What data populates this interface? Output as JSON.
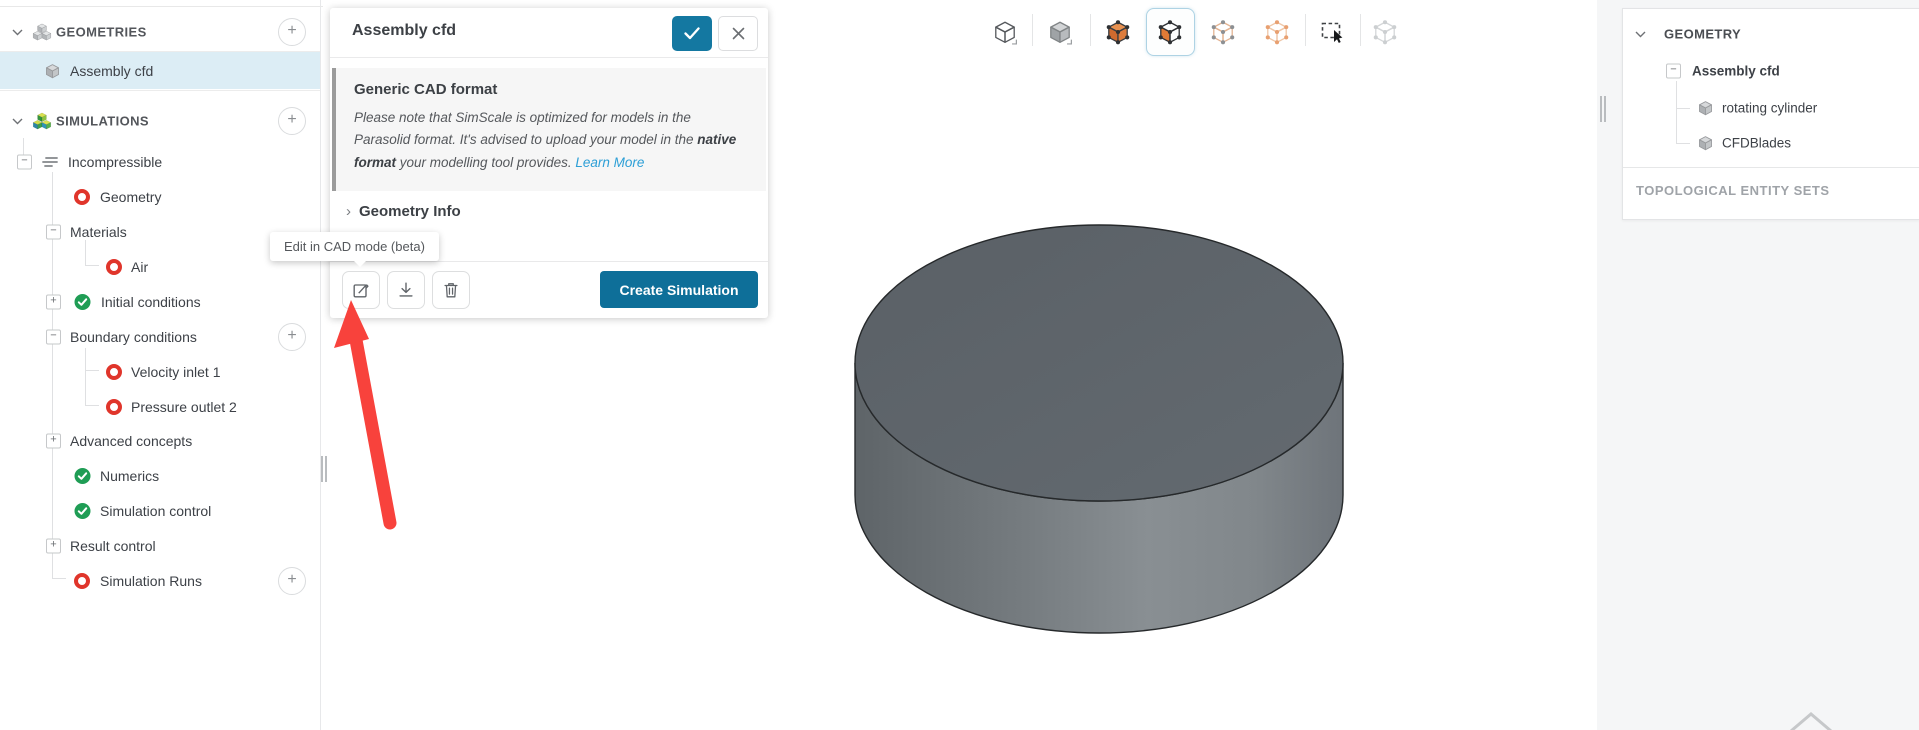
{
  "colors": {
    "accent": "#0e6f99",
    "selected_row": "#dcedf5",
    "link": "#2d9fd6",
    "arrow": "#f8423c",
    "status_incomplete": "#e0352b",
    "status_complete": "#1f9d55",
    "active_icon_border": "#aed3e4"
  },
  "sidebar": {
    "items": [
      {
        "label": "GEOMETRIES",
        "level": "header",
        "icon": "cubes-gray-icon",
        "chevron": true,
        "plus": true
      },
      {
        "label": "Assembly cfd",
        "level": "assembly",
        "icon": "cube-icon",
        "selected": true
      },
      {
        "label": "SIMULATIONS",
        "level": "header",
        "icon": "cubes-color-icon",
        "chevron": true,
        "plus": true
      },
      {
        "label": "Incompressible",
        "level": "l0",
        "icon": "flow-lines-icon",
        "expander": "minus"
      },
      {
        "label": "Geometry",
        "level": "l2",
        "icon": "status-incomplete-icon"
      },
      {
        "label": "Materials",
        "level": "l1",
        "expander": "minus"
      },
      {
        "label": "Air",
        "level": "l3",
        "icon": "status-incomplete-icon"
      },
      {
        "label": "Initial conditions",
        "level": "l1",
        "icon": "status-complete-icon",
        "expander": "plus"
      },
      {
        "label": "Boundary conditions",
        "level": "l1",
        "expander": "minus",
        "plus": true
      },
      {
        "label": "Velocity inlet 1",
        "level": "l3",
        "icon": "status-incomplete-icon"
      },
      {
        "label": "Pressure outlet 2",
        "level": "l3",
        "icon": "status-incomplete-icon"
      },
      {
        "label": "Advanced concepts",
        "level": "l1",
        "expander": "plus"
      },
      {
        "label": "Numerics",
        "level": "l2",
        "icon": "status-complete-icon"
      },
      {
        "label": "Simulation control",
        "level": "l2",
        "icon": "status-complete-icon"
      },
      {
        "label": "Result control",
        "level": "l1",
        "expander": "plus"
      },
      {
        "label": "Simulation Runs",
        "level": "l2",
        "icon": "status-incomplete-icon",
        "plus": true
      }
    ]
  },
  "panel": {
    "title": "Assembly cfd",
    "info_heading": "Generic CAD format",
    "info_body_1": "Please note that SimScale is optimized for models in the Parasolid format. It's advised to upload your model in the ",
    "info_body_bold": "native format",
    "info_body_2": " your modelling tool provides. ",
    "info_link": "Learn More",
    "section_label": "Geometry Info",
    "create_button": "Create Simulation"
  },
  "tooltip": {
    "text": "Edit in CAD mode (beta)"
  },
  "toolbar": {
    "icons": [
      {
        "name": "view-wireframe-cube-icon"
      },
      {
        "name": "view-solid-cube-icon"
      },
      {
        "name": "select-volume-icon"
      },
      {
        "name": "select-face-icon",
        "active": true
      },
      {
        "name": "select-edge-icon"
      },
      {
        "name": "select-vertex-icon"
      },
      {
        "name": "box-select-icon"
      },
      {
        "name": "select-assembly-icon",
        "disabled": true
      }
    ]
  },
  "right_panel": {
    "header": "GEOMETRY",
    "items": [
      {
        "label": "Assembly cfd",
        "bold": true,
        "expander": "minus"
      },
      {
        "label": "rotating cylinder",
        "icon": "cube-icon"
      },
      {
        "label": "CFDBlades",
        "icon": "cube-icon"
      }
    ],
    "topological_label": "TOPOLOGICAL ENTITY SETS"
  },
  "viewport": {
    "model": "gray cylinder"
  }
}
